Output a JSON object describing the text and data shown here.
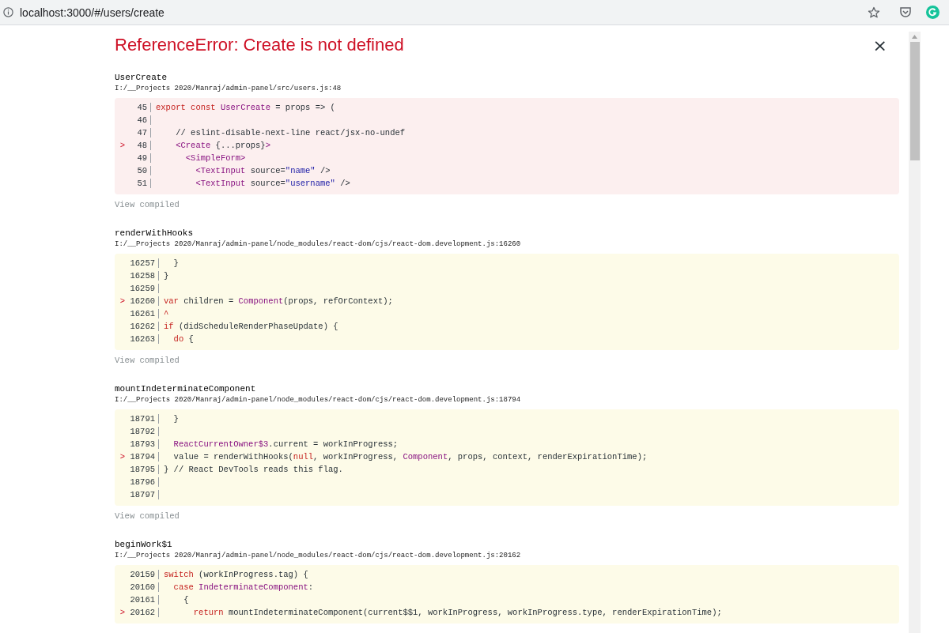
{
  "browser": {
    "url": "localhost:3000/#/users/create"
  },
  "error": {
    "title": "ReferenceError: Create is not defined",
    "close": "×"
  },
  "frames": [
    {
      "name": "UserCreate",
      "path": "I:/__Projects 2020/Manraj/admin-panel/src/users.js:48",
      "app_code": true,
      "link": "View compiled",
      "lines": [
        {
          "number": "45",
          "tokens": [
            {
              "kind": "keyword",
              "text": "export const "
            },
            {
              "kind": "name",
              "text": "UserCreate"
            },
            {
              "kind": "plain",
              "text": " = props => ("
            }
          ]
        },
        {
          "number": "46"
        },
        {
          "number": "47",
          "tokens": [
            {
              "kind": "plain",
              "text": "    // eslint-disable-next-line react/jsx-no-undef"
            }
          ]
        },
        {
          "number": "48",
          "marker": ">",
          "tokens": [
            {
              "kind": "name",
              "text": "    <Create"
            },
            {
              "kind": "plain",
              "text": " {...props}"
            },
            {
              "kind": "name",
              "text": ">"
            }
          ]
        },
        {
          "number": "49",
          "tokens": [
            {
              "kind": "name",
              "text": "      <SimpleForm>"
            }
          ]
        },
        {
          "number": "50",
          "tokens": [
            {
              "kind": "name",
              "text": "        <TextInput"
            },
            {
              "kind": "plain",
              "text": " source="
            },
            {
              "kind": "string",
              "text": "\"name\""
            },
            {
              "kind": "plain",
              "text": " />"
            }
          ]
        },
        {
          "number": "51",
          "tokens": [
            {
              "kind": "name",
              "text": "        <TextInput"
            },
            {
              "kind": "plain",
              "text": " source="
            },
            {
              "kind": "string",
              "text": "\"username\""
            },
            {
              "kind": "plain",
              "text": " />"
            }
          ]
        }
      ]
    },
    {
      "name": "renderWithHooks",
      "path": "I:/__Projects 2020/Manraj/admin-panel/node_modules/react-dom/cjs/react-dom.development.js:16260",
      "app_code": false,
      "link": "View compiled",
      "lines": [
        {
          "number": "16257",
          "tokens": [
            {
              "kind": "plain",
              "text": "  }"
            }
          ]
        },
        {
          "number": "16258",
          "tokens": [
            {
              "kind": "plain",
              "text": "}"
            }
          ]
        },
        {
          "number": "16259"
        },
        {
          "number": "16260",
          "marker": ">",
          "tokens": [
            {
              "kind": "keyword",
              "text": "var"
            },
            {
              "kind": "plain",
              "text": " children = "
            },
            {
              "kind": "name",
              "text": "Component"
            },
            {
              "kind": "plain",
              "text": "(props, refOrContext);"
            }
          ]
        },
        {
          "number": "16261",
          "tokens": [
            {
              "kind": "keyword",
              "text": "^"
            }
          ]
        },
        {
          "number": "16262",
          "tokens": [
            {
              "kind": "keyword",
              "text": "if"
            },
            {
              "kind": "plain",
              "text": " (didScheduleRenderPhaseUpdate) {"
            }
          ]
        },
        {
          "number": "16263",
          "tokens": [
            {
              "kind": "keyword",
              "text": "  do"
            },
            {
              "kind": "plain",
              "text": " {"
            }
          ]
        }
      ]
    },
    {
      "name": "mountIndeterminateComponent",
      "path": "I:/__Projects 2020/Manraj/admin-panel/node_modules/react-dom/cjs/react-dom.development.js:18794",
      "app_code": false,
      "link": "View compiled",
      "lines": [
        {
          "number": "18791",
          "tokens": [
            {
              "kind": "plain",
              "text": "  }"
            }
          ]
        },
        {
          "number": "18792"
        },
        {
          "number": "18793",
          "tokens": [
            {
              "kind": "name",
              "text": "  ReactCurrentOwner$3"
            },
            {
              "kind": "plain",
              "text": ".current = workInProgress;"
            }
          ]
        },
        {
          "number": "18794",
          "marker": ">",
          "tokens": [
            {
              "kind": "plain",
              "text": "  value = renderWithHooks("
            },
            {
              "kind": "keyword",
              "text": "null"
            },
            {
              "kind": "plain",
              "text": ", workInProgress, "
            },
            {
              "kind": "name",
              "text": "Component"
            },
            {
              "kind": "plain",
              "text": ", props, context, renderExpirationTime);"
            }
          ]
        },
        {
          "number": "18795",
          "tokens": [
            {
              "kind": "plain",
              "text": "} // React DevTools reads this flag."
            }
          ]
        },
        {
          "number": "18796"
        },
        {
          "number": "18797"
        }
      ]
    },
    {
      "name": "beginWork$1",
      "path": "I:/__Projects 2020/Manraj/admin-panel/node_modules/react-dom/cjs/react-dom.development.js:20162",
      "app_code": false,
      "lines": [
        {
          "number": "20159",
          "tokens": [
            {
              "kind": "keyword",
              "text": "switch"
            },
            {
              "kind": "plain",
              "text": " (workInProgress.tag) {"
            }
          ]
        },
        {
          "number": "20160",
          "tokens": [
            {
              "kind": "keyword",
              "text": "  case"
            },
            {
              "kind": "name",
              "text": " IndeterminateComponent"
            },
            {
              "kind": "plain",
              "text": ":"
            }
          ]
        },
        {
          "number": "20161",
          "tokens": [
            {
              "kind": "plain",
              "text": "    {"
            }
          ]
        },
        {
          "number": "20162",
          "marker": ">",
          "tokens": [
            {
              "kind": "keyword",
              "text": "      return"
            },
            {
              "kind": "plain",
              "text": " mountIndeterminateComponent(current$$1, workInProgress, workInProgress.type, renderExpirationTime);"
            }
          ]
        }
      ]
    }
  ]
}
